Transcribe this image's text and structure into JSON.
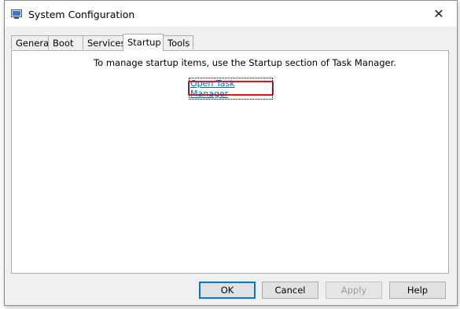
{
  "window": {
    "title": "System Configuration",
    "app_icon": "msconfig-icon",
    "close_icon": "close-icon",
    "close_glyph": "✕"
  },
  "tabs": [
    {
      "label": "General"
    },
    {
      "label": "Boot"
    },
    {
      "label": "Services"
    },
    {
      "label": "Startup",
      "active": true
    },
    {
      "label": "Tools"
    }
  ],
  "startup": {
    "message": "To manage startup items, use the Startup section of Task Manager.",
    "link_label": "Open Task Manager",
    "highlight_color": "#e3131d"
  },
  "buttons": {
    "ok": "OK",
    "cancel": "Cancel",
    "apply": "Apply",
    "help": "Help"
  },
  "colors": {
    "link": "#0066cc",
    "default_button_border": "#0078d7"
  }
}
